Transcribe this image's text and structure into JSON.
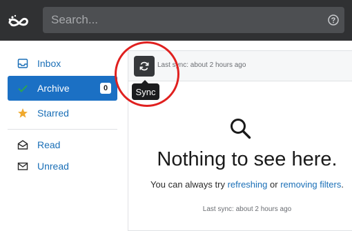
{
  "search": {
    "placeholder": "Search..."
  },
  "sidebar": {
    "items": [
      {
        "label": "Inbox",
        "icon": "inbox-icon"
      },
      {
        "label": "Archive",
        "icon": "check-icon",
        "badge": "0",
        "active": true
      },
      {
        "label": "Starred",
        "icon": "star-icon"
      }
    ],
    "filters": [
      {
        "label": "Read",
        "icon": "envelope-open-icon"
      },
      {
        "label": "Unread",
        "icon": "envelope-icon"
      }
    ]
  },
  "panel": {
    "last_sync_top": "Last sync: about 2 hours ago",
    "sync_tooltip": "Sync",
    "empty_title": "Nothing to see here.",
    "empty_text_prefix": "You can always try ",
    "refreshing_link": "refreshing",
    "empty_text_mid": " or ",
    "removing_filters_link": "removing filters",
    "empty_text_suffix": ".",
    "last_sync_bottom": "Last sync: about 2 hours ago"
  },
  "colors": {
    "topbar": "#303133",
    "accent": "#1b70c4",
    "check": "#2ea44f",
    "star": "#f0a92e",
    "highlight": "#e0201f"
  }
}
